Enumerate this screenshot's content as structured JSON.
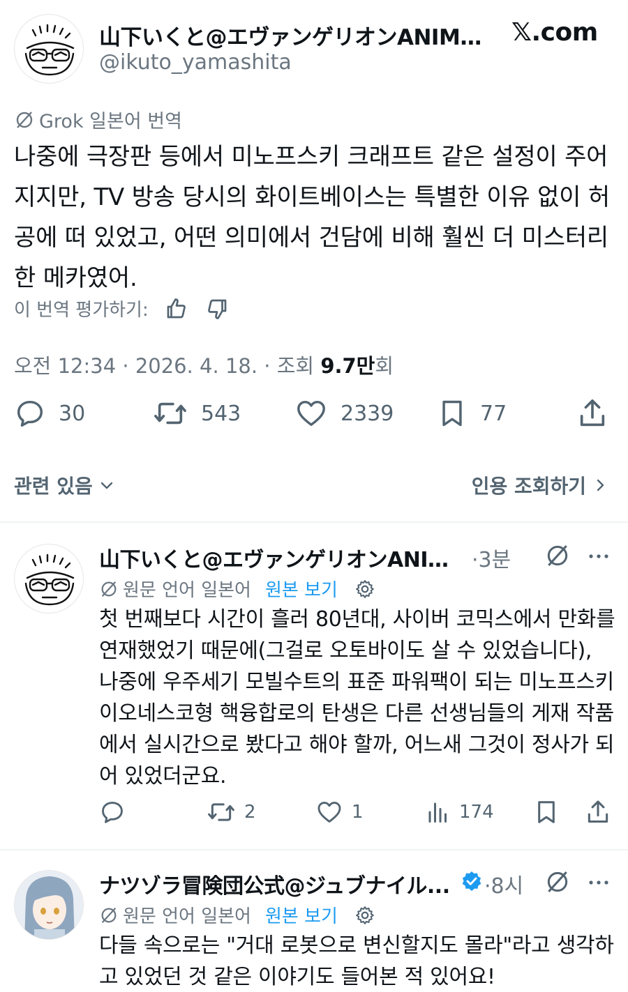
{
  "header": {
    "author_name": "山下いくと@エヴァンゲリオンANIMA...",
    "handle": "@ikuto_yamashita",
    "site": "𝕏.com"
  },
  "tweet": {
    "translate_label": "Grok 일본어 번역",
    "text": "나중에 극장판 등에서 미노프스키 크래프트 같은 설정이 주어지지만, TV 방송 당시의 화이트베이스는 특별한 이유 없이 허공에 떠 있었고, 어떤 의미에서 건담에 비해 훨씬 더 미스터리한 메카였어.",
    "rate_label": "이 번역 평가하기:",
    "time": "오전 12:34",
    "date": "2026. 4. 18.",
    "views_prefix": "조회",
    "views_count": "9.7만",
    "views_suffix": "회",
    "replies": "30",
    "retweets": "543",
    "likes": "2339",
    "bookmarks": "77",
    "related_label": "관련 있음",
    "quote_label": "인용 조회하기"
  },
  "replies": [
    {
      "name": "山下いくと@エヴァンゲリオンANIM...",
      "time": "·3분",
      "lang_label": "원문 언어 일본어",
      "link_label": "원본 보기",
      "text": "첫 번째보다 시간이 흘러 80년대, 사이버 코믹스에서 만화를 연재했었기 때문에(그걸로 오토바이도 살 수 있었습니다), 나중에 우주세기 모빌수트의 표준 파워팩이 되는 미노프스키 이오네스코형 핵융합로의 탄생은 다른 선생님들의 게재 작품에서 실시간으로 봤다고 해야 할까, 어느새 그것이 정사가 되어 있었더군요.",
      "retweets": "2",
      "likes": "1",
      "views": "174"
    },
    {
      "name": "ナツゾラ冒険団公式@ジュブナイル...",
      "time": "·8시",
      "lang_label": "원문 언어 일본어",
      "link_label": "원본 보기",
      "text": "다들 속으로는 \"거대 로봇으로 변신할지도 몰라\"라고 생각하고 있었던 것 같은 이야기도 들어본 적 있어요!"
    }
  ],
  "colors": {
    "accent": "#1d9bf0",
    "text": "#0f1419",
    "muted": "#6b7680",
    "verified": "#1d9bf0"
  }
}
